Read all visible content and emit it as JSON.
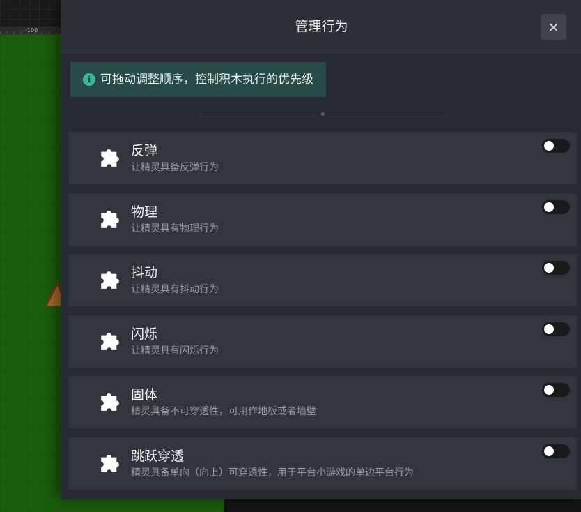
{
  "scene": {
    "ruler_label": "-100"
  },
  "modal": {
    "title": "管理行为",
    "close_icon": "close-icon",
    "tip": {
      "icon": "info-icon",
      "text": "可拖动调整顺序，控制积木执行的优先级"
    },
    "behaviors": [
      {
        "name": "反弹",
        "description": "让精灵具备反弹行为",
        "icon": "puzzle-icon",
        "enabled": false
      },
      {
        "name": "物理",
        "description": "让精灵具有物理行为",
        "icon": "puzzle-icon",
        "enabled": false
      },
      {
        "name": "抖动",
        "description": "让精灵具有抖动行为",
        "icon": "puzzle-icon",
        "enabled": false
      },
      {
        "name": "闪烁",
        "description": "让精灵具有闪烁行为",
        "icon": "puzzle-icon",
        "enabled": false
      },
      {
        "name": "固体",
        "description": "精灵具备不可穿透性，可用作地板或者墙壁",
        "icon": "puzzle-icon",
        "enabled": false
      },
      {
        "name": "跳跃穿透",
        "description": "精灵具备单向（向上）可穿透性，用于平台小游戏的单边平台行为",
        "icon": "puzzle-icon",
        "enabled": false
      }
    ]
  },
  "colors": {
    "modal_bg": "#272a31",
    "card_bg": "#32353d",
    "tip_bg": "#284b48",
    "tip_icon": "#3bb894",
    "field_green": "#1b5d0c"
  }
}
